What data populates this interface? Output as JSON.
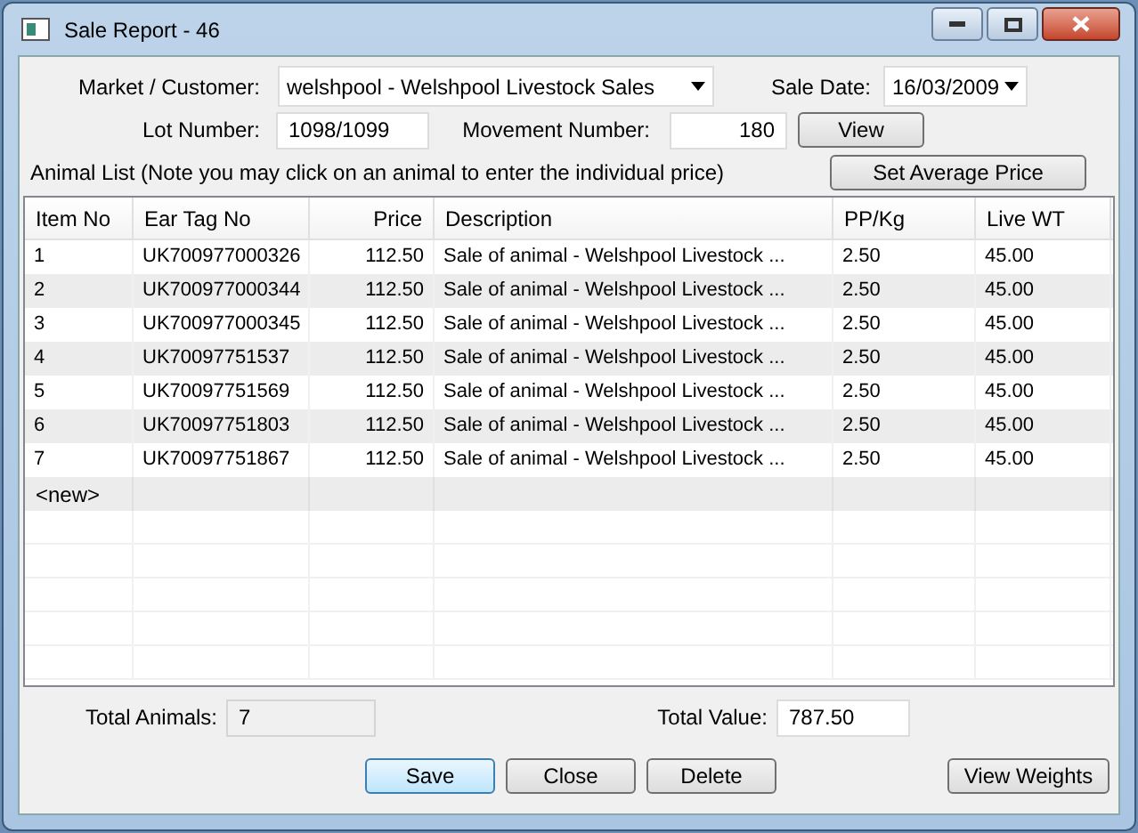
{
  "window": {
    "title": "Sale Report - 46"
  },
  "market": {
    "label": "Market / Customer:",
    "value": "welshpool - Welshpool Livestock Sales"
  },
  "sale_date": {
    "label": "Sale Date:",
    "value": "16/03/2009"
  },
  "lot": {
    "label": "Lot Number:",
    "value": "1098/1099"
  },
  "movement": {
    "label": "Movement Number:",
    "value": "180",
    "button": "View"
  },
  "animal_list": {
    "note": "Animal List (Note you may click on an animal to enter the individual price)",
    "button": "Set Average Price"
  },
  "table": {
    "columns": [
      "Item No",
      "Ear Tag No",
      "Price",
      "Description",
      "PP/Kg",
      "Live WT"
    ],
    "rows": [
      [
        "1",
        "UK700977000326",
        "112.50",
        "Sale of animal - Welshpool Livestock ...",
        "2.50",
        "45.00"
      ],
      [
        "2",
        "UK700977000344",
        "112.50",
        "Sale of animal - Welshpool Livestock ...",
        "2.50",
        "45.00"
      ],
      [
        "3",
        "UK700977000345",
        "112.50",
        "Sale of animal - Welshpool Livestock ...",
        "2.50",
        "45.00"
      ],
      [
        "4",
        "UK70097751537",
        "112.50",
        "Sale of animal - Welshpool Livestock ...",
        "2.50",
        "45.00"
      ],
      [
        "5",
        "UK70097751569",
        "112.50",
        "Sale of animal - Welshpool Livestock ...",
        "2.50",
        "45.00"
      ],
      [
        "6",
        "UK70097751803",
        "112.50",
        "Sale of animal - Welshpool Livestock ...",
        "2.50",
        "45.00"
      ],
      [
        "7",
        "UK70097751867",
        "112.50",
        "Sale of animal - Welshpool Livestock ...",
        "2.50",
        "45.00"
      ]
    ],
    "new_row": "<new>"
  },
  "total_animals": {
    "label": "Total Animals:",
    "value": "7",
    "disabled": true
  },
  "total_value": {
    "label": "Total Value:",
    "value": "787.50",
    "disabled": false
  },
  "buttons": [
    {
      "label": "Save",
      "default": true
    },
    {
      "label": "Close",
      "default": false
    },
    {
      "label": "Delete",
      "default": false
    }
  ],
  "view_weights": "View Weights"
}
